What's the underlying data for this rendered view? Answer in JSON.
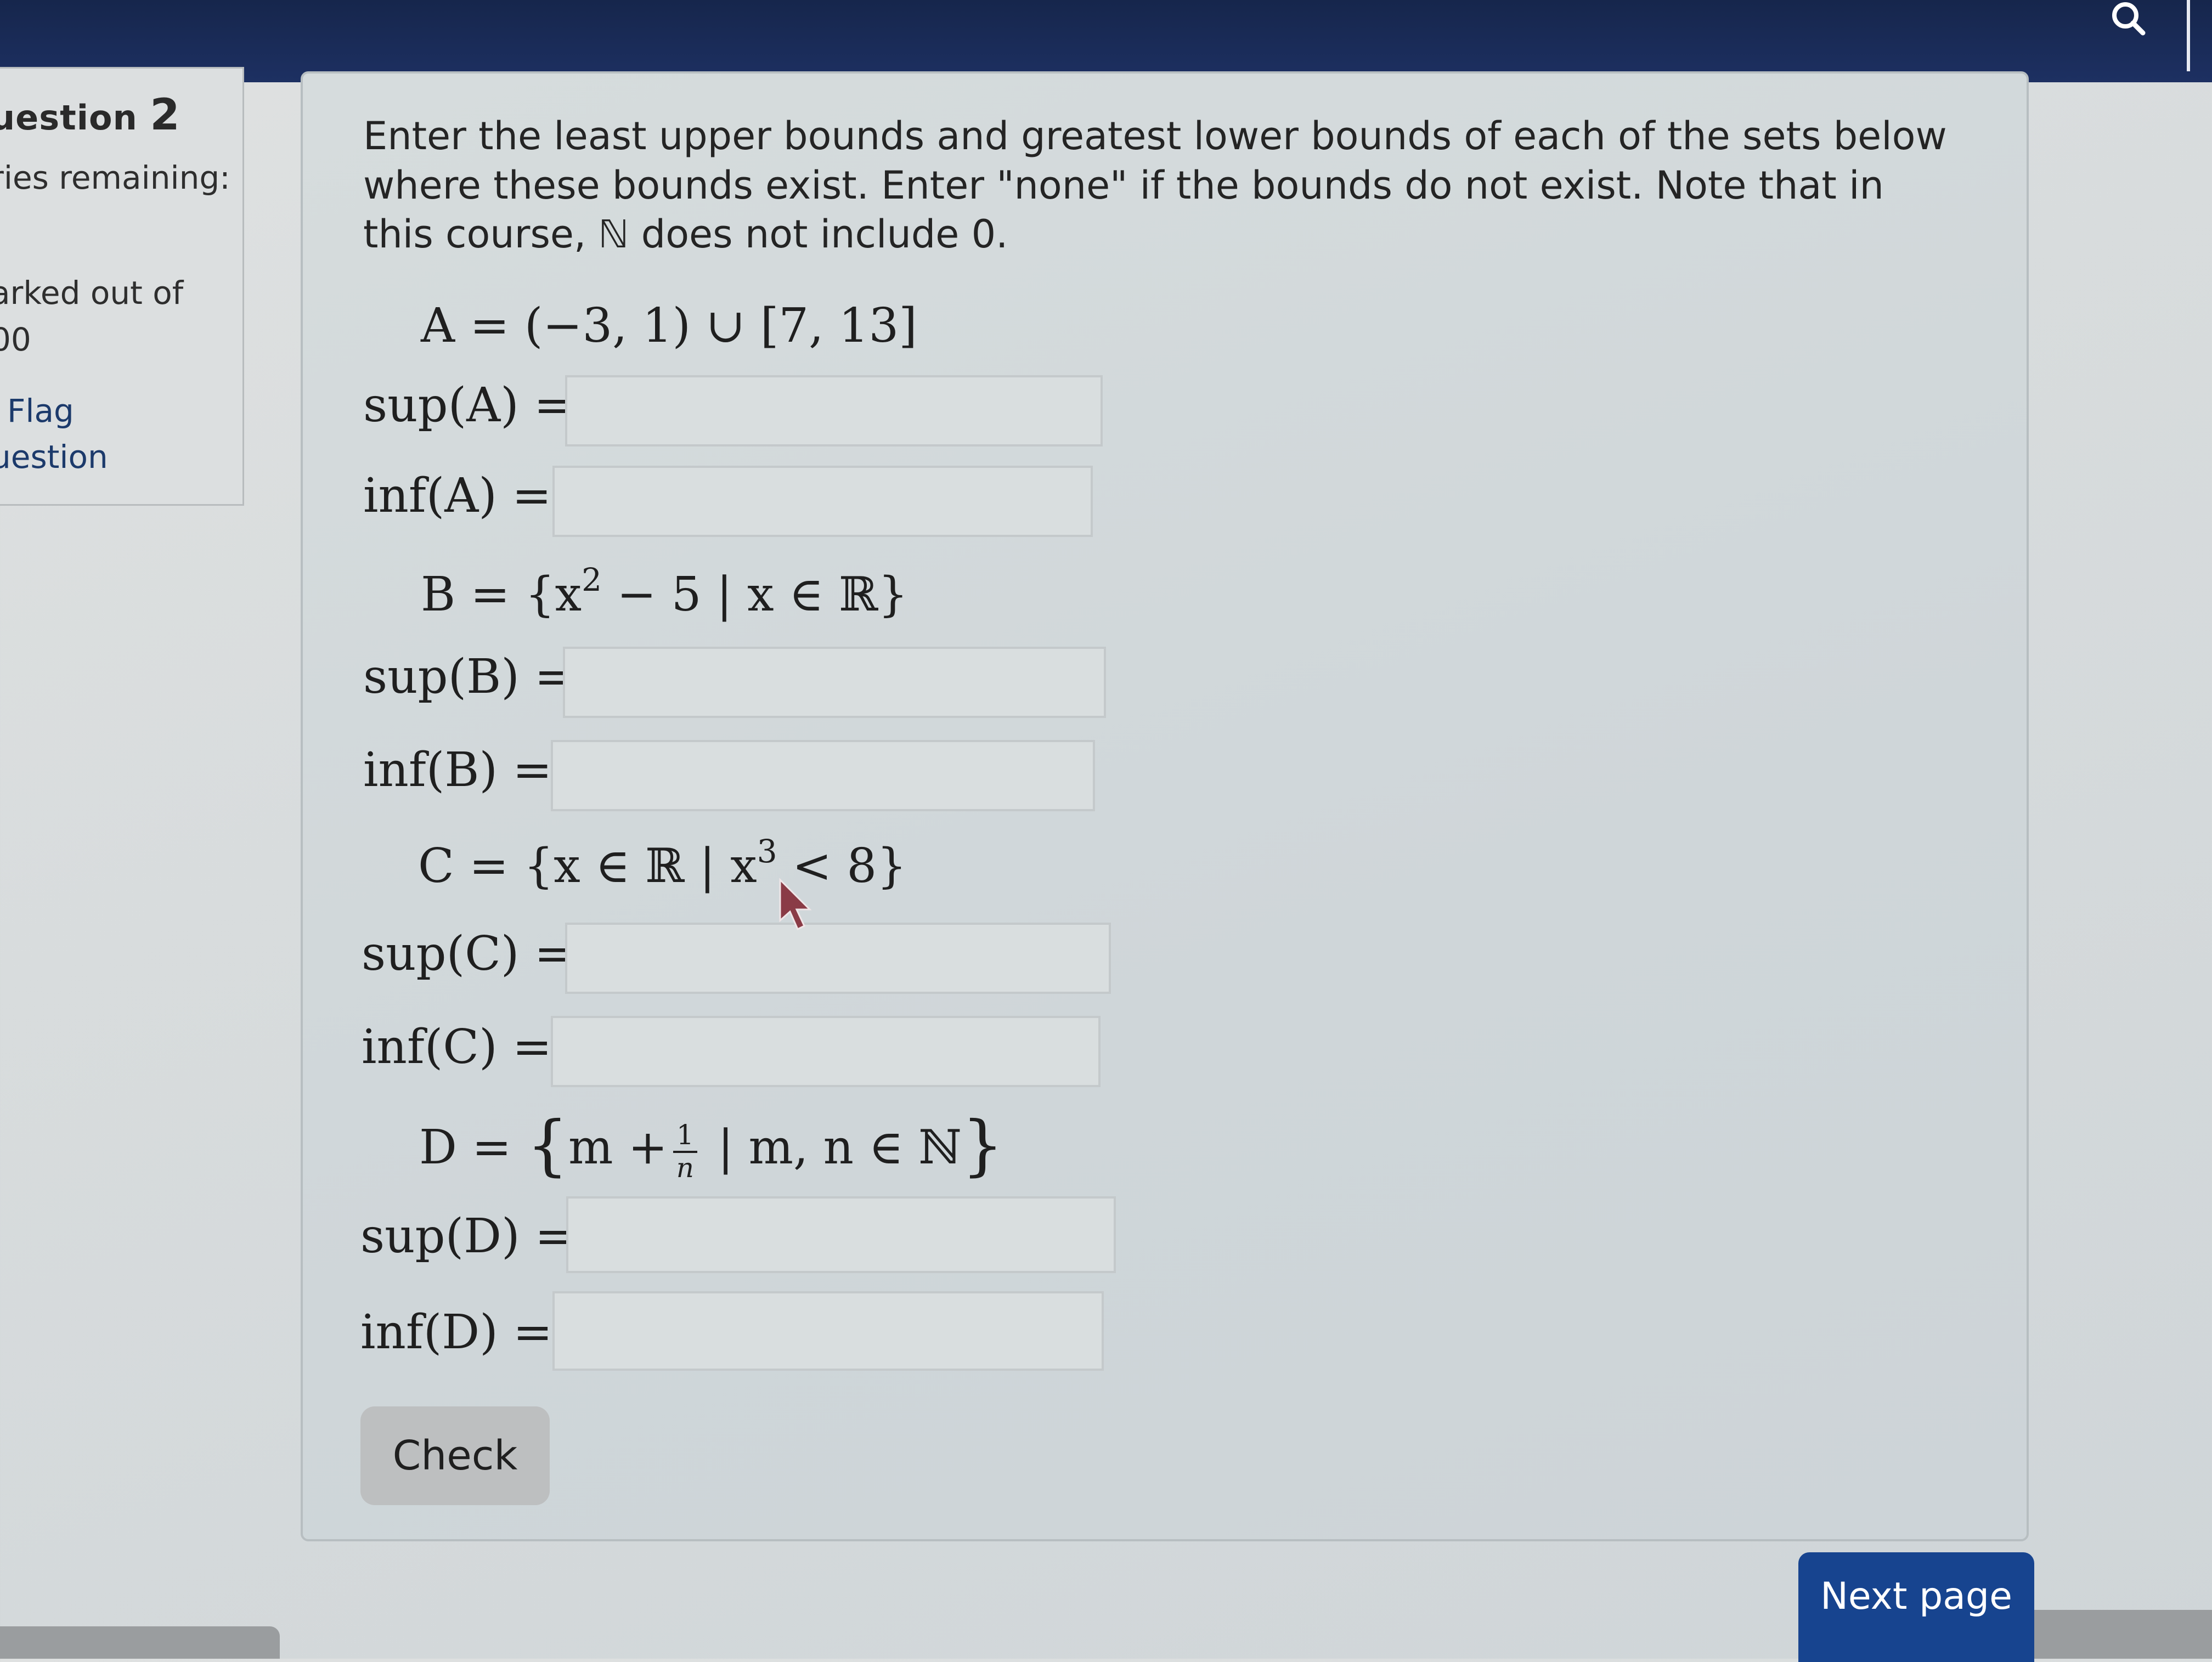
{
  "header": {
    "search_icon": "search-icon"
  },
  "info": {
    "question_label": "uestion",
    "question_number": "2",
    "tries_label": "ries remaining:",
    "marked_label": "arked out of",
    "marked_value": "00",
    "flag_line1": "Flag",
    "flag_line2": "uestion"
  },
  "question": {
    "prompt": "Enter the least upper bounds and greatest lower bounds of each of the sets below where these bounds exist. Enter \"none\" if the bounds do not exist. Note that in this course, ℕ does not include 0.",
    "sets": [
      {
        "definition": "A = (−3, 1) ∪ [7, 13]",
        "sup_label": "sup(A) =",
        "inf_label": "inf(A) =",
        "sup_value": "",
        "inf_value": ""
      },
      {
        "definition_pre": "B = {x",
        "definition_exp": "2",
        "definition_post": " − 5 | x ∈ ℝ}",
        "sup_label": "sup(B) =",
        "inf_label": "inf(B) =",
        "sup_value": "",
        "inf_value": ""
      },
      {
        "definition_pre": "C = {x ∈ ℝ | x",
        "definition_exp": "3",
        "definition_post": " < 8}",
        "sup_label": "sup(C) =",
        "inf_label": "inf(C) =",
        "sup_value": "",
        "inf_value": ""
      },
      {
        "definition_pre": "D = ",
        "brace_open": "{",
        "definition_mid": "m +",
        "frac_num": "1",
        "frac_den": "n",
        "definition_post": " | m, n ∈ ℕ",
        "brace_close": "}",
        "sup_label": "sup(D) =",
        "inf_label": "inf(D) =",
        "sup_value": "",
        "inf_value": ""
      }
    ],
    "check_label": "Check"
  },
  "navigation": {
    "next_label": "Next page"
  },
  "colors": {
    "topbar": "#16264c",
    "next_button": "#17448f",
    "panel_bg": "#d6dcdd",
    "check_button": "#bdbfc0"
  }
}
